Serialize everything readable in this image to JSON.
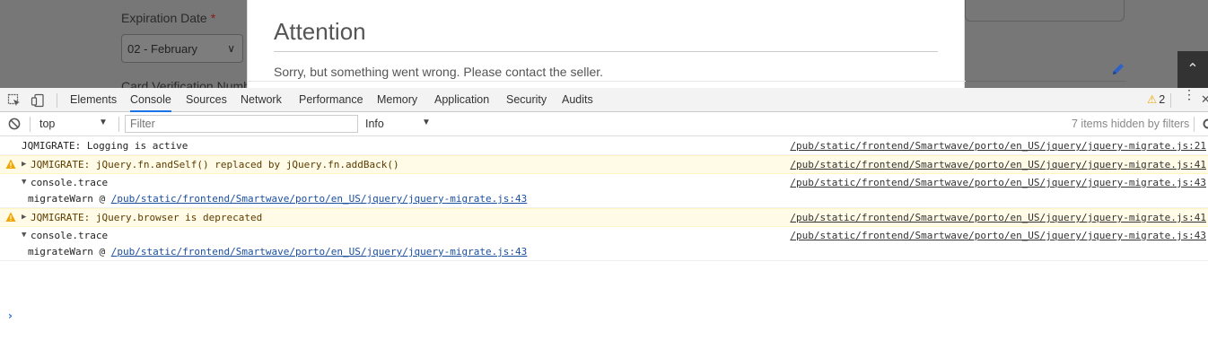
{
  "page": {
    "expiration_label": "Expiration Date",
    "required_mark": "*",
    "month_value": "02 - February",
    "cvn_label": "Card Verification Number",
    "scroll_top_icon": "chevron-up-icon",
    "pencil_icon": "pencil-icon"
  },
  "modal": {
    "title": "Attention",
    "message": "Sorry, but something went wrong. Please contact the seller."
  },
  "devtools": {
    "tabs": [
      "Elements",
      "Console",
      "Sources",
      "Network",
      "Performance",
      "Memory",
      "Application",
      "Security",
      "Audits"
    ],
    "active_tab": "Console",
    "warning_count": "2",
    "accent_color": "#1a73e8",
    "filter": {
      "context": "top",
      "placeholder": "Filter",
      "level": "Info",
      "hidden_text": "7 items hidden by filters"
    },
    "messages": [
      {
        "type": "log",
        "text": "JQMIGRATE: Logging is active",
        "source": "/pub/static/frontend/Smartwave/porto/en_US/jquery/jquery-migrate.js:21"
      },
      {
        "type": "warn",
        "text": "JQMIGRATE: jQuery.fn.andSelf() replaced by jQuery.fn.addBack()",
        "source": "/pub/static/frontend/Smartwave/porto/en_US/jquery/jquery-migrate.js:41"
      },
      {
        "type": "trace",
        "text": "console.trace",
        "source": "/pub/static/frontend/Smartwave/porto/en_US/jquery/jquery-migrate.js:43",
        "frame_fn": "migrateWarn @ ",
        "frame_link": "/pub/static/frontend/Smartwave/porto/en_US/jquery/jquery-migrate.js:43"
      },
      {
        "type": "warn",
        "text": "JQMIGRATE: jQuery.browser is deprecated",
        "source": "/pub/static/frontend/Smartwave/porto/en_US/jquery/jquery-migrate.js:41"
      },
      {
        "type": "trace",
        "text": "console.trace",
        "source": "/pub/static/frontend/Smartwave/porto/en_US/jquery/jquery-migrate.js:43",
        "frame_fn": "migrateWarn @ ",
        "frame_link": "/pub/static/frontend/Smartwave/porto/en_US/jquery/jquery-migrate.js:43"
      }
    ],
    "prompt_symbol": "›"
  }
}
